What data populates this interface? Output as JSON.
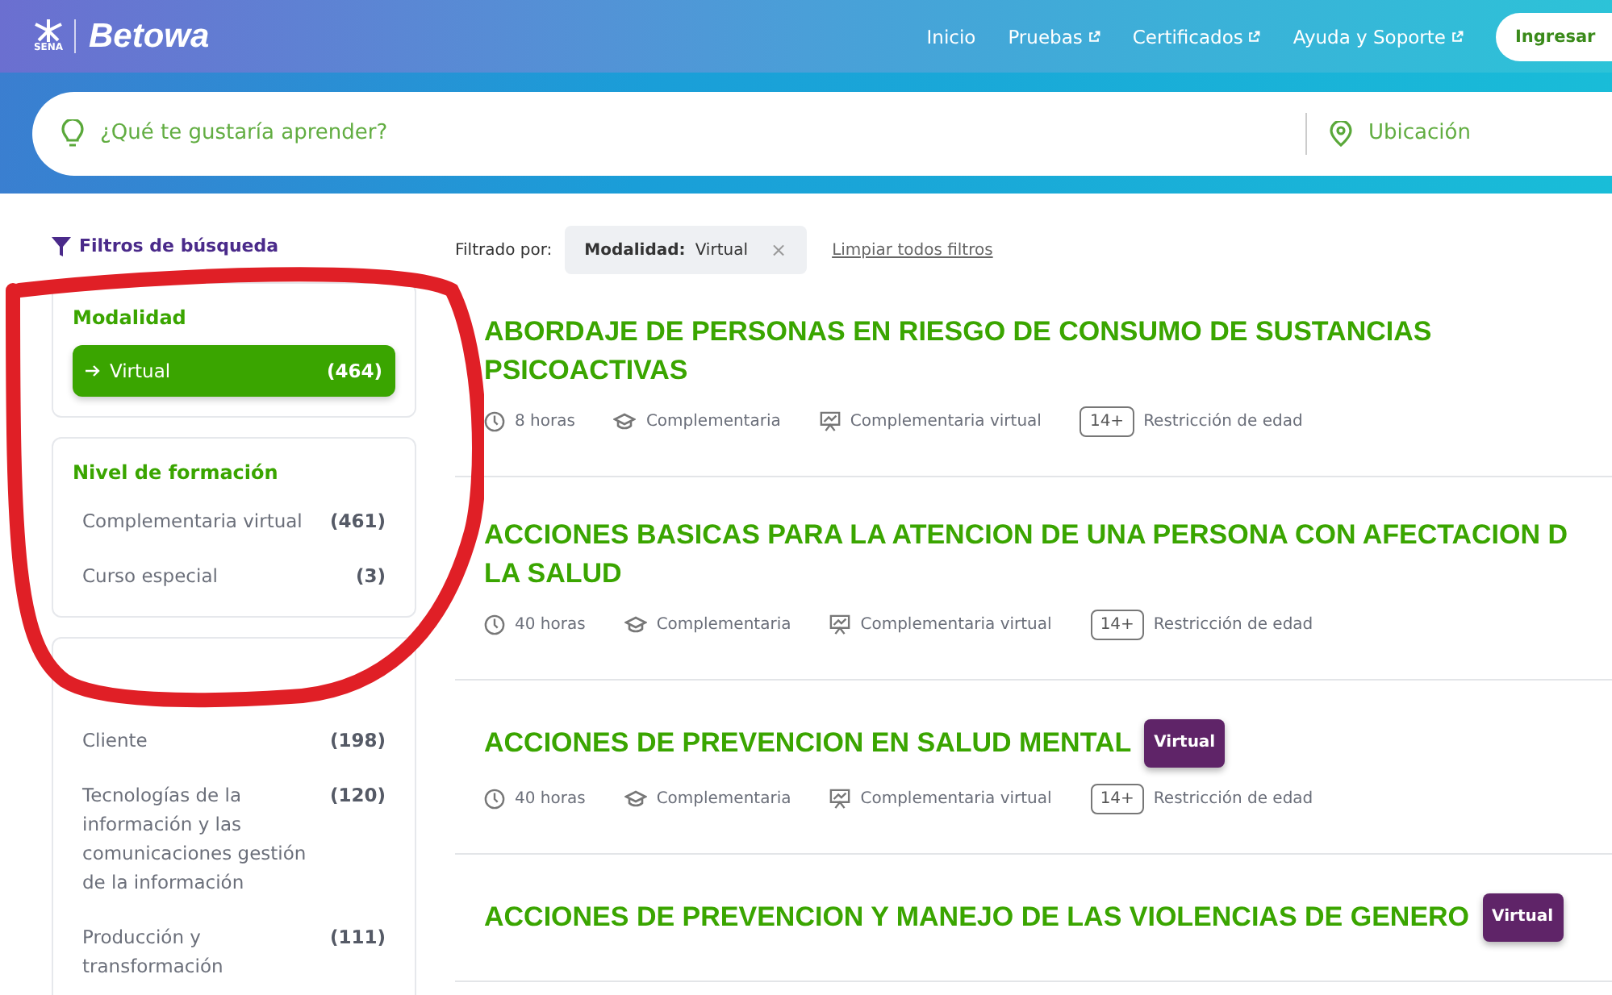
{
  "header": {
    "logo_small": "SENA",
    "brand": "Betowa",
    "nav": [
      {
        "label": "Inicio",
        "external": false
      },
      {
        "label": "Pruebas",
        "external": true
      },
      {
        "label": "Certificados",
        "external": true
      },
      {
        "label": "Ayuda y Soporte",
        "external": true
      }
    ],
    "login": "Ingresar"
  },
  "search": {
    "placeholder": "¿Qué te gustaría aprender?",
    "location_placeholder": "Ubicación"
  },
  "sidebar": {
    "title": "Filtros de búsqueda",
    "groups": [
      {
        "title": "Modalidad",
        "items": [
          {
            "label": "Virtual",
            "count": "(464)",
            "selected": true
          }
        ]
      },
      {
        "title": "Nivel de formación",
        "items": [
          {
            "label": "Complementaria virtual",
            "count": "(461)",
            "selected": false
          },
          {
            "label": "Curso especial",
            "count": "(3)",
            "selected": false
          }
        ]
      },
      {
        "items": [
          {
            "label": "Cliente",
            "count": "(198)",
            "selected": false
          },
          {
            "label": "Tecnologías de la información y las comunicaciones gestión de la información",
            "count": "(120)",
            "selected": false
          },
          {
            "label": "Producción y transformación",
            "count": "(111)",
            "selected": false
          }
        ]
      }
    ]
  },
  "filters": {
    "label": "Filtrado por:",
    "chips": [
      {
        "key": "Modalidad:",
        "value": "Virtual",
        "remove": "×"
      }
    ],
    "clear": "Limpiar todos filtros"
  },
  "courses": [
    {
      "title_lines": [
        "ABORDAJE DE PERSONAS EN RIESGO DE CONSUMO DE SUSTANCIAS",
        "PSICOACTIVAS"
      ],
      "hours": "8 horas",
      "level": "Complementaria",
      "type": "Complementaria virtual",
      "age": "14+",
      "age_label": "Restricción de edad"
    },
    {
      "title_lines": [
        "ACCIONES BASICAS PARA LA ATENCION DE UNA PERSONA CON AFECTACION D",
        "LA SALUD"
      ],
      "hours": "40 horas",
      "level": "Complementaria",
      "type": "Complementaria virtual",
      "age": "14+",
      "age_label": "Restricción de edad"
    },
    {
      "title_lines": [
        "ACCIONES DE PREVENCION EN SALUD MENTAL"
      ],
      "badge": "Virtual",
      "hours": "40 horas",
      "level": "Complementaria",
      "type": "Complementaria virtual",
      "age": "14+",
      "age_label": "Restricción de edad"
    },
    {
      "title_lines": [
        "ACCIONES DE PREVENCION Y MANEJO DE LAS VIOLENCIAS DE GENERO"
      ],
      "badge": "Virtual"
    }
  ],
  "annotation": {
    "kind": "loop"
  }
}
